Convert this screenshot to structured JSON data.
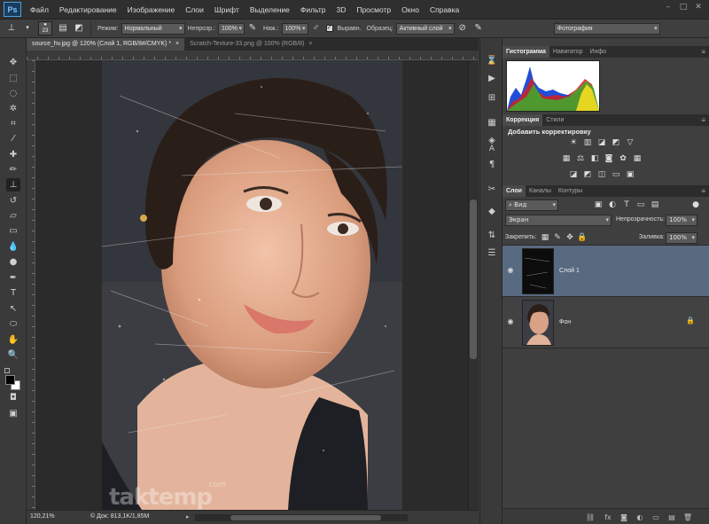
{
  "app": {
    "logo": "Ps"
  },
  "menu": [
    "Файл",
    "Редактирование",
    "Изображение",
    "Слои",
    "Шрифт",
    "Выделение",
    "Фильтр",
    "3D",
    "Просмотр",
    "Окно",
    "Справка"
  ],
  "window_controls": {
    "minimize": "–",
    "restore": "□",
    "close": "✕"
  },
  "options": {
    "brush_size": "23",
    "mode_label": "Режим:",
    "mode_value": "Нормальный",
    "opacity_label": "Непрозр.:",
    "opacity_value": "100%",
    "flow_label": "Наж.:",
    "flow_value": "100%",
    "aligned_label": "Выравн.",
    "sample_label": "Образец:",
    "sample_value": "Активный слой",
    "workspace": "Фотография"
  },
  "tabs": [
    {
      "label": "source_hv.jpg @ 120% (Слой 1, RGB/8#/CMYK) *",
      "close": "×"
    },
    {
      "label": "Scratch-Texture-33.png @ 100% (RGB/8)",
      "close": "×"
    }
  ],
  "status": {
    "zoom": "120,21%",
    "doc": "© Док: 813,1K/1,85M"
  },
  "watermark": {
    "text": "taktemp",
    "sub": ".com"
  },
  "panels": {
    "histogram_tabs": [
      "Гистограмма",
      "Навигатор",
      "Инфо"
    ],
    "adjust_tabs": [
      "Коррекция",
      "Стили"
    ],
    "adjust_title": "Добавить корректировку",
    "layers_tabs": [
      "Слои",
      "Каналы",
      "Контуры"
    ],
    "filter_kind": "Вид",
    "blend_mode": "Экран",
    "opacity_label": "Непрозрачность:",
    "opacity_value": "100%",
    "lock_label": "Закрепить:",
    "fill_label": "Заливка:",
    "fill_value": "100%",
    "layers": [
      {
        "name": "Слой 1",
        "selected": true
      },
      {
        "name": "Фон",
        "selected": false
      }
    ]
  },
  "colors": {
    "accent_selected_layer": "#586a80",
    "panel_bg": "#3f3f3f",
    "histogram_bg": "#ffffff"
  }
}
